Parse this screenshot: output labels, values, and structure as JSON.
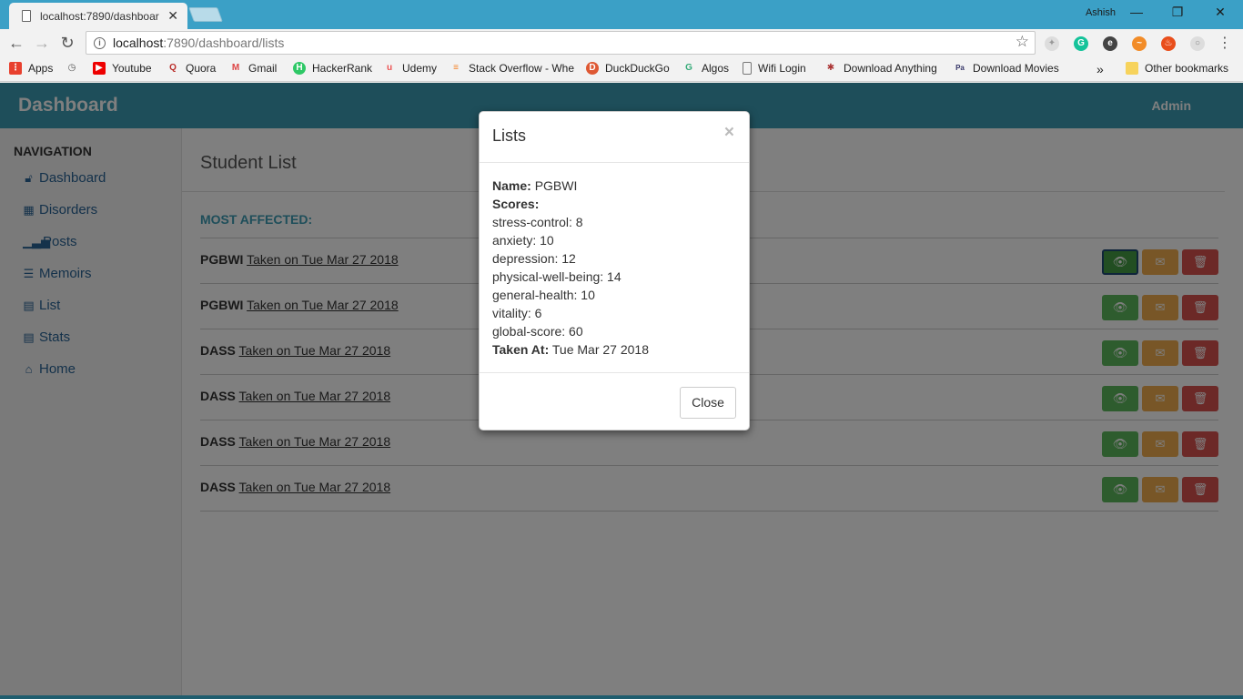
{
  "browser": {
    "tab_title": "localhost:7890/dashboar",
    "user": "Ashish",
    "url_host": "localhost",
    "url_path": ":7890/dashboard/lists",
    "bookmarks": [
      "Apps",
      "Youtube",
      "Quora",
      "Gmail",
      "HackerRank",
      "Udemy",
      "Stack Overflow - Whe",
      "DuckDuckGo",
      "Algos",
      "Wifi Login",
      "Download Anything",
      "Download Movies"
    ],
    "more": "»",
    "other_bookmarks": "Other bookmarks"
  },
  "navbar": {
    "brand": "Dashboard",
    "user": "Admin"
  },
  "sidebar": {
    "heading": "NAVIGATION",
    "items": [
      {
        "label": "Dashboard",
        "icon": "lock-icon"
      },
      {
        "label": "Disorders",
        "icon": "grid-icon"
      },
      {
        "label": "Posts",
        "icon": "signal-icon"
      },
      {
        "label": "Memoirs",
        "icon": "list-icon"
      },
      {
        "label": "List",
        "icon": "clipboard-icon"
      },
      {
        "label": "Stats",
        "icon": "clipboard-icon"
      },
      {
        "label": "Home",
        "icon": "home-icon"
      }
    ]
  },
  "main": {
    "title": "Student List",
    "section": "MOST AFFECTED:",
    "rows": [
      {
        "name": "PGBWI",
        "link": "Taken on Tue Mar 27 2018"
      },
      {
        "name": "PGBWI",
        "link": "Taken on Tue Mar 27 2018"
      },
      {
        "name": "DASS",
        "link": "Taken on Tue Mar 27 2018"
      },
      {
        "name": "DASS",
        "link": "Taken on Tue Mar 27 2018"
      },
      {
        "name": "DASS",
        "link": "Taken on Tue Mar 27 2018"
      },
      {
        "name": "DASS",
        "link": "Taken on Tue Mar 27 2018"
      }
    ]
  },
  "modal": {
    "title": "Lists",
    "close_x": "×",
    "name_label": "Name:",
    "name_value": "PGBWI",
    "scores_label": "Scores:",
    "scores": [
      "stress-control: 8",
      "anxiety: 10",
      "depression: 12",
      "physical-well-being: 14",
      "general-health: 10",
      "vitality: 6",
      "global-score: 60"
    ],
    "taken_label": "Taken At:",
    "taken_value": "Tue Mar 27 2018",
    "close_button": "Close"
  },
  "colors": {
    "navbar": "#3d9cb4",
    "view": "#5cb85c",
    "mail": "#f0ad4e",
    "delete": "#d9534f",
    "link": "#2a6496"
  }
}
